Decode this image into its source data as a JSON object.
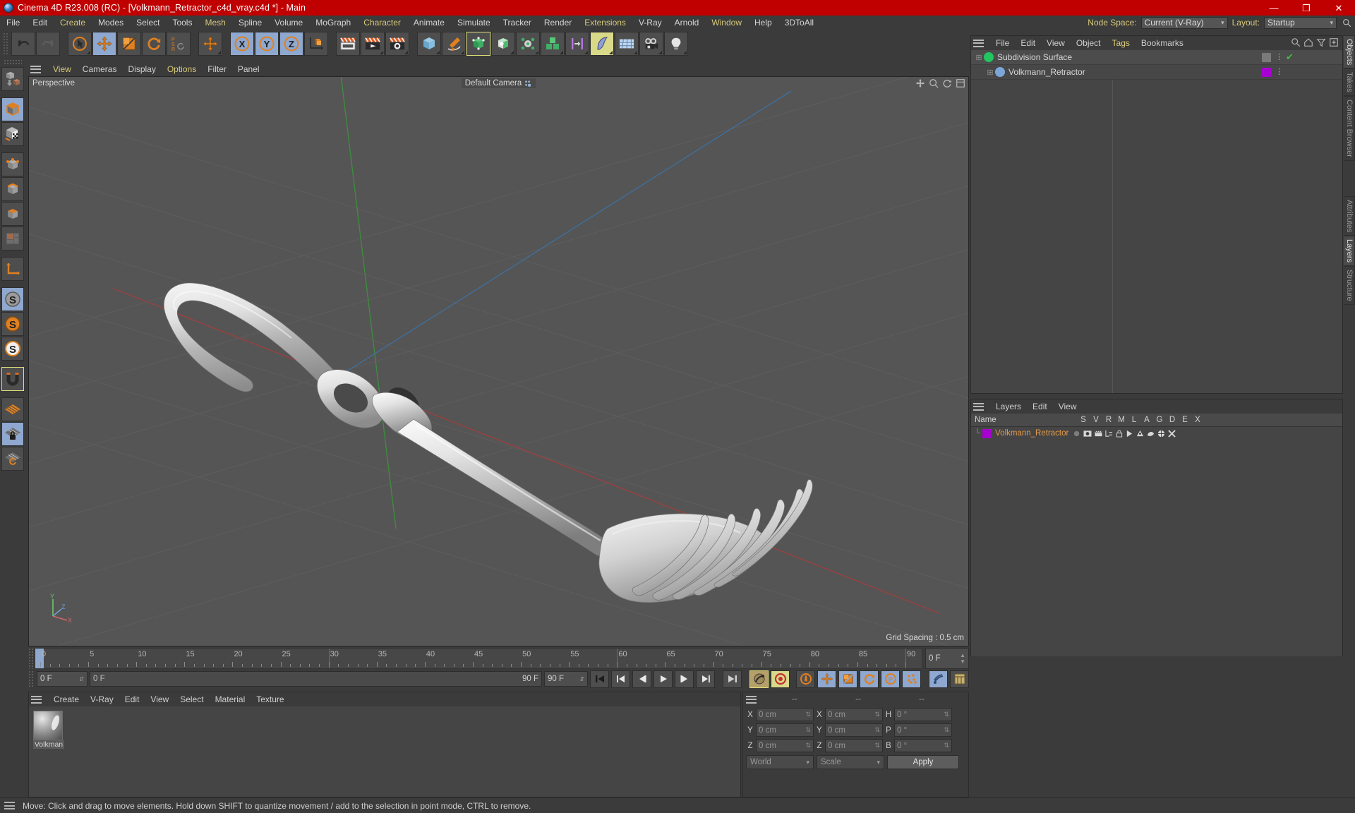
{
  "window": {
    "title": "Cinema 4D R23.008 (RC) - [Volkmann_Retractor_c4d_vray.c4d *] - Main",
    "minimize": "—",
    "maximize": "❐",
    "close": "✕"
  },
  "menubar": {
    "items": [
      {
        "label": "File",
        "highlight": false
      },
      {
        "label": "Edit",
        "highlight": false
      },
      {
        "label": "Create",
        "highlight": true
      },
      {
        "label": "Modes",
        "highlight": false
      },
      {
        "label": "Select",
        "highlight": false
      },
      {
        "label": "Tools",
        "highlight": false
      },
      {
        "label": "Mesh",
        "highlight": true
      },
      {
        "label": "Spline",
        "highlight": false
      },
      {
        "label": "Volume",
        "highlight": false
      },
      {
        "label": "MoGraph",
        "highlight": false
      },
      {
        "label": "Character",
        "highlight": true
      },
      {
        "label": "Animate",
        "highlight": false
      },
      {
        "label": "Simulate",
        "highlight": false
      },
      {
        "label": "Tracker",
        "highlight": false
      },
      {
        "label": "Render",
        "highlight": false
      },
      {
        "label": "Extensions",
        "highlight": true
      },
      {
        "label": "V-Ray",
        "highlight": false
      },
      {
        "label": "Arnold",
        "highlight": false
      },
      {
        "label": "Window",
        "highlight": true
      },
      {
        "label": "Help",
        "highlight": false
      },
      {
        "label": "3DToAll",
        "highlight": false
      }
    ],
    "node_space_label": "Node Space:",
    "node_space_value": "Current (V-Ray)",
    "layout_label": "Layout:",
    "layout_value": "Startup"
  },
  "viewport": {
    "menu": [
      {
        "label": "View",
        "highlight": true
      },
      {
        "label": "Cameras",
        "highlight": false
      },
      {
        "label": "Display",
        "highlight": false
      },
      {
        "label": "Options",
        "highlight": true
      },
      {
        "label": "Filter",
        "highlight": false
      },
      {
        "label": "Panel",
        "highlight": false
      }
    ],
    "label": "Perspective",
    "camera": "Default Camera",
    "grid_spacing": "Grid Spacing : 0.5 cm",
    "axis_x": "X",
    "axis_y": "Y",
    "axis_z": "Z"
  },
  "objects_panel": {
    "menu": [
      {
        "label": "File",
        "highlight": false
      },
      {
        "label": "Edit",
        "highlight": false
      },
      {
        "label": "View",
        "highlight": false
      },
      {
        "label": "Object",
        "highlight": false
      },
      {
        "label": "Tags",
        "highlight": true
      },
      {
        "label": "Bookmarks",
        "highlight": false
      }
    ],
    "rows": [
      {
        "name": "Subdivision Surface",
        "indent": 0,
        "color": "#22c55e",
        "tag_color": "#7a7a7a",
        "check": "✔"
      },
      {
        "name": "Volkmann_Retractor",
        "indent": 1,
        "color": "#7aa7d8",
        "tag_color": "#a600d0",
        "check": ""
      }
    ]
  },
  "layers_panel": {
    "menu": [
      {
        "label": "Layers",
        "highlight": false
      },
      {
        "label": "Edit",
        "highlight": false
      },
      {
        "label": "View",
        "highlight": false
      }
    ],
    "columns": [
      "Name",
      "S",
      "V",
      "R",
      "M",
      "L",
      "A",
      "G",
      "D",
      "E",
      "X"
    ],
    "rows": [
      {
        "name": "Volkmann_Retractor",
        "color": "#a600d0"
      }
    ]
  },
  "right_tabs": [
    {
      "label": "Objects",
      "active": true
    },
    {
      "label": "Takes",
      "active": false
    },
    {
      "label": "Content Browser",
      "active": false
    }
  ],
  "right_tabs_lower": [
    {
      "label": "Attributes",
      "active": false
    },
    {
      "label": "Layers",
      "active": true
    },
    {
      "label": "Structure",
      "active": false
    }
  ],
  "timeline": {
    "ticks": [
      0,
      5,
      10,
      15,
      20,
      25,
      30,
      35,
      40,
      45,
      50,
      55,
      60,
      65,
      70,
      75,
      80,
      85,
      90
    ],
    "min": 0,
    "max": 90,
    "current_frame_display": "0 F",
    "current_frame_field": "0 F",
    "range_start": "0 F",
    "range_end": "90 F",
    "end_field": "90 F"
  },
  "material_manager": {
    "menu": [
      {
        "label": "Create",
        "highlight": false
      },
      {
        "label": "V-Ray",
        "highlight": false
      },
      {
        "label": "Edit",
        "highlight": false
      },
      {
        "label": "View",
        "highlight": false
      },
      {
        "label": "Select",
        "highlight": false
      },
      {
        "label": "Material",
        "highlight": false
      },
      {
        "label": "Texture",
        "highlight": false
      }
    ],
    "materials": [
      {
        "name": "Volkman"
      }
    ]
  },
  "coordinates": {
    "header": [
      "--",
      "--",
      "--"
    ],
    "position": {
      "label_x": "X",
      "label_y": "Y",
      "label_z": "Z",
      "x": "0 cm",
      "y": "0 cm",
      "z": "0 cm"
    },
    "size": {
      "label_x": "X",
      "label_y": "Y",
      "label_z": "Z",
      "x": "0 cm",
      "y": "0 cm",
      "z": "0 cm"
    },
    "rotation": {
      "label_h": "H",
      "label_p": "P",
      "label_b": "B",
      "h": "0 °",
      "p": "0 °",
      "b": "0 °"
    },
    "world_select": "World",
    "scale_select": "Scale",
    "apply_button": "Apply"
  },
  "statusbar": {
    "message": "Move: Click and drag to move elements. Hold down SHIFT to quantize movement / add to the selection in point mode, CTRL to remove."
  },
  "colors": {
    "title_bar": "#c00000",
    "panel_bg": "#3b3b3b",
    "viewport_bg": "#555555",
    "accent_orange": "#e08020",
    "select_blue": "#8fa8cf",
    "select_yellow": "#d9d98a",
    "layer_color": "#a600d0"
  }
}
